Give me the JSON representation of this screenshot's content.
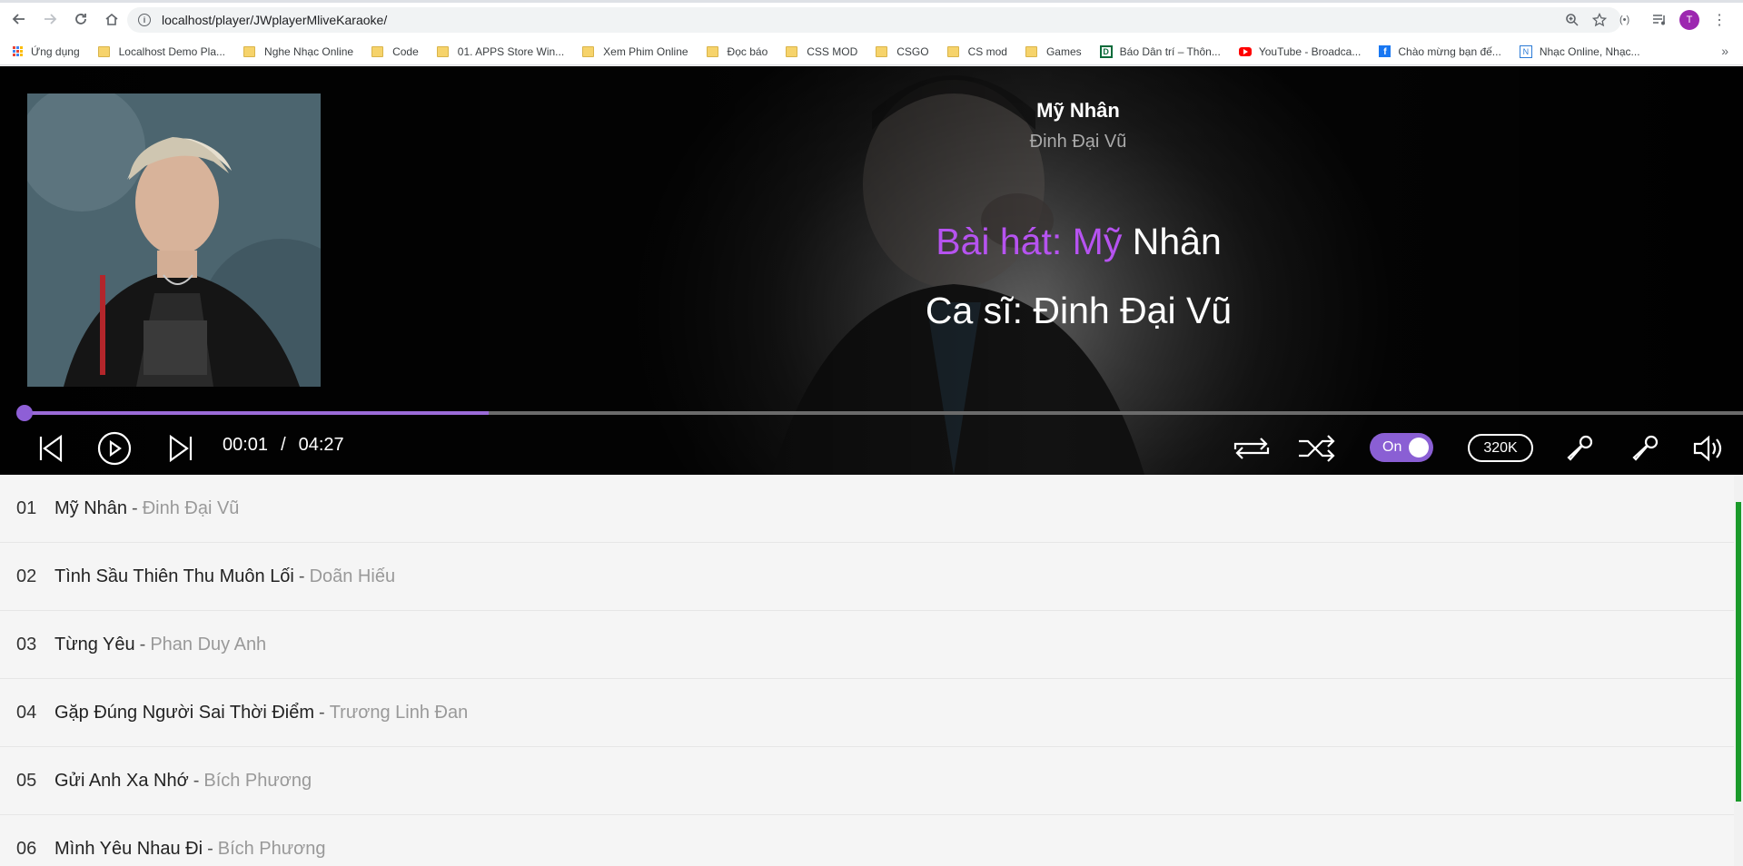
{
  "browser": {
    "url": "localhost/player/JWplayerMliveKaraoke/",
    "avatar_letter": "T",
    "bookmarks": [
      {
        "label": "Ứng dụng",
        "icon": "apps-icon"
      },
      {
        "label": "Localhost Demo Pla...",
        "icon": "folder-icon"
      },
      {
        "label": "Nghe Nhạc Online",
        "icon": "folder-icon"
      },
      {
        "label": "Code",
        "icon": "folder-icon"
      },
      {
        "label": "01. APPS Store Win...",
        "icon": "folder-icon"
      },
      {
        "label": "Xem Phim Online",
        "icon": "folder-icon"
      },
      {
        "label": "Đọc báo",
        "icon": "folder-icon"
      },
      {
        "label": "CSS MOD",
        "icon": "folder-icon"
      },
      {
        "label": "CSGO",
        "icon": "folder-icon"
      },
      {
        "label": "CS mod",
        "icon": "folder-icon"
      },
      {
        "label": "Games",
        "icon": "folder-icon"
      },
      {
        "label": "Báo Dân trí – Thôn...",
        "icon": "dantri-icon"
      },
      {
        "label": "YouTube - Broadca...",
        "icon": "youtube-icon"
      },
      {
        "label": "Chào mừng bạn đế...",
        "icon": "facebook-icon"
      },
      {
        "label": "Nhạc Online, Nhạc...",
        "icon": "nhaccuatui-icon"
      }
    ],
    "more": "»"
  },
  "player": {
    "title": "Mỹ Nhân",
    "artist": "Đinh Đại Vũ",
    "lyric_line1_sung": "Bài hát: Mỹ ",
    "lyric_line1_unsung": "Nhân",
    "lyric_line2": "Ca sĩ: Đinh Đại Vũ",
    "current_time": "00:01",
    "time_separator": "/",
    "duration": "04:27",
    "progress_percent": 27,
    "buffered_percent": 27,
    "karaoke_toggle_label": "On",
    "quality_label": "320K",
    "accent_color": "#9b6bd8",
    "lyric_highlight_color": "#b653f0"
  },
  "playlist": [
    {
      "num": "01",
      "song": "Mỹ Nhân",
      "artist": "Đinh Đại Vũ"
    },
    {
      "num": "02",
      "song": "Tình Sầu Thiên Thu Muôn Lối",
      "artist": "Doãn Hiếu"
    },
    {
      "num": "03",
      "song": "Từng Yêu",
      "artist": "Phan Duy Anh"
    },
    {
      "num": "04",
      "song": "Gặp Đúng Người Sai Thời Điểm",
      "artist": "Trương Linh Đan"
    },
    {
      "num": "05",
      "song": "Gửi Anh Xa Nhớ",
      "artist": "Bích Phương"
    },
    {
      "num": "06",
      "song": "Mình Yêu Nhau Đi",
      "artist": "Bích Phương"
    }
  ],
  "separator": "-"
}
